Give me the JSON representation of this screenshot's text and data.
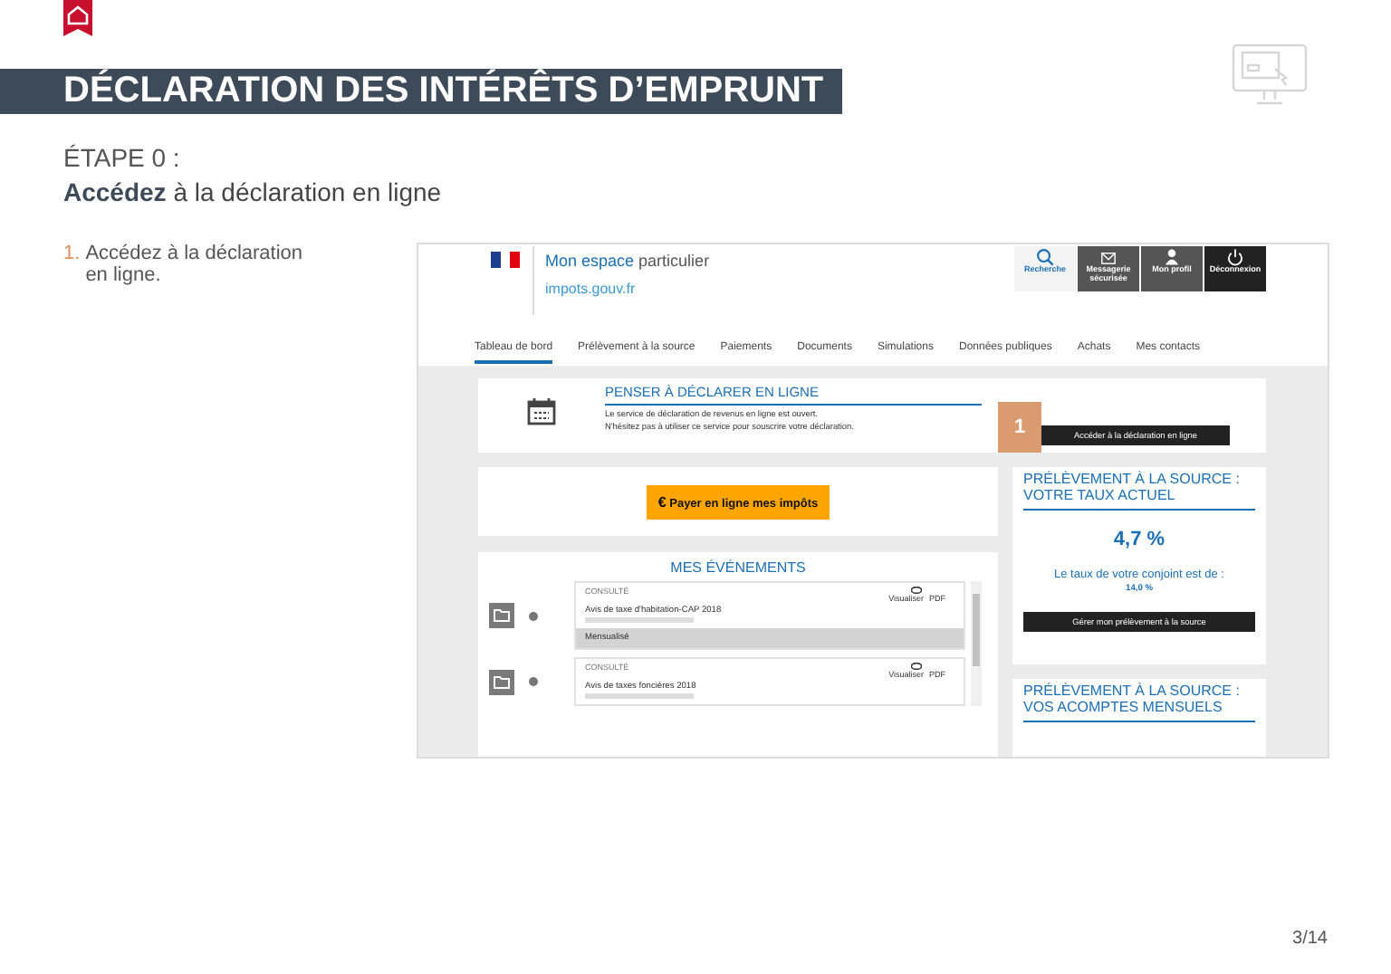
{
  "header": {
    "title": "DÉCLARATION DES INTÉRÊTS D’EMPRUNT",
    "step_label": "ÉTAPE 0 :",
    "step_text": "**Accédez** à la déclaration en ligne"
  },
  "instructions": [
    {
      "number": "1.",
      "text": "Accédez à la déclaration en ligne."
    }
  ],
  "screenshot": {
    "brand": {
      "title_part1": "Mon espace",
      "title_part2": "particulier",
      "site": "impots.gouv.fr"
    },
    "header_buttons": [
      {
        "kind": "light",
        "label": "Recherche"
      },
      {
        "kind": "dark",
        "label": "Messagerie sécurisée"
      },
      {
        "kind": "dark",
        "label": "Mon profil"
      },
      {
        "kind": "darker",
        "label": "Déconnexion"
      }
    ],
    "tabs": [
      {
        "label": "Tableau de bord",
        "selected": true
      },
      {
        "label": "Prélèvement à la source",
        "selected": false
      },
      {
        "label": "Paiements",
        "selected": false
      },
      {
        "label": "Documents",
        "selected": false
      },
      {
        "label": "Simulations",
        "selected": false
      },
      {
        "label": "Données publiques",
        "selected": false
      },
      {
        "label": "Achats",
        "selected": false
      },
      {
        "label": "Mes contacts",
        "selected": false
      }
    ],
    "notice": {
      "title": "PENSER À DÉCLARER EN LIGNE",
      "lines": [
        "Le service de déclaration de revenus en ligne est ouvert.",
        "N'hésitez pas à utiliser ce service pour souscrire votre déclaration."
      ],
      "callout": "1",
      "button": "Accéder à la déclaration en ligne"
    },
    "pay_button": {
      "symbol": "€",
      "label": "Payer en ligne mes impôts"
    },
    "events": {
      "title": "MES ÉVÉNEMENTS",
      "items": [
        {
          "status": "CONSULTÉ",
          "view": "Visualiser",
          "pdf": "PDF",
          "title": "Avis de taxe d'habitation-CAP 2018",
          "footer": "Mensualisé"
        },
        {
          "status": "CONSULTÉ",
          "view": "Visualiser",
          "pdf": "PDF",
          "title": "Avis de taxes foncières 2018"
        }
      ]
    },
    "rate_card": {
      "title": "PRÉLÈVEMENT À LA SOURCE : VOTRE TAUX ACTUEL",
      "rate": "4,7 %",
      "spouse_label": "Le taux de votre conjoint est de :",
      "spouse_rate": "14,0 %",
      "button": "Gérer mon prélèvement à la source"
    },
    "installments_card": {
      "title": "PRÉLÈVEMENT À LA SOURCE : VOS ACOMPTES MENSUELS"
    }
  },
  "page_number": "3/14"
}
